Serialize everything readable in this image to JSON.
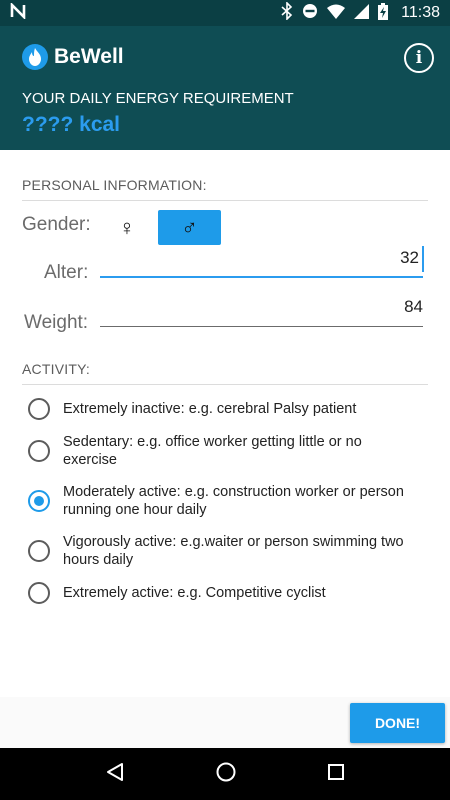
{
  "status_bar": {
    "time": "11:38",
    "icons": [
      "n-notification-icon",
      "bluetooth-icon",
      "do-not-disturb-icon",
      "wifi-icon",
      "signal-icon",
      "battery-charging-icon"
    ]
  },
  "app": {
    "name": "BeWell",
    "logo_icon": "flame-icon",
    "info_icon": "info-icon",
    "info_glyph": "i",
    "requirement_label": "YOUR DAILY ENERGY REQUIREMENT",
    "requirement_value": "???? kcal"
  },
  "personal": {
    "section_title": "PERSONAL INFORMATION:",
    "gender_label": "Gender:",
    "female_symbol": "♀",
    "male_symbol": "♂",
    "selected_gender": "male",
    "age_label": "Alter:",
    "age_value": "32",
    "weight_label": "Weight:",
    "weight_value": "84"
  },
  "activity": {
    "section_title": "ACTIVITY:",
    "options": [
      {
        "label": "Extremely inactive: e.g. cerebral Palsy patient",
        "checked": false
      },
      {
        "label": "Sedentary: e.g. office worker getting little or no exercise",
        "checked": false
      },
      {
        "label": "Moderately active: e.g. construction worker or person running one hour daily",
        "checked": true
      },
      {
        "label": "Vigorously active: e.g.waiter or person swimming two hours daily",
        "checked": false
      },
      {
        "label": "Extremely active: e.g. Competitive cyclist",
        "checked": false
      }
    ]
  },
  "done_label": "DONE!",
  "colors": {
    "status_bar": "#0b3f44",
    "app_bar": "#0f4d54",
    "accent": "#1e9be9",
    "kcal_text": "#2b9cef"
  },
  "nav": {
    "back_icon": "back-triangle-icon",
    "home_icon": "home-circle-icon",
    "recents_icon": "recents-square-icon"
  }
}
